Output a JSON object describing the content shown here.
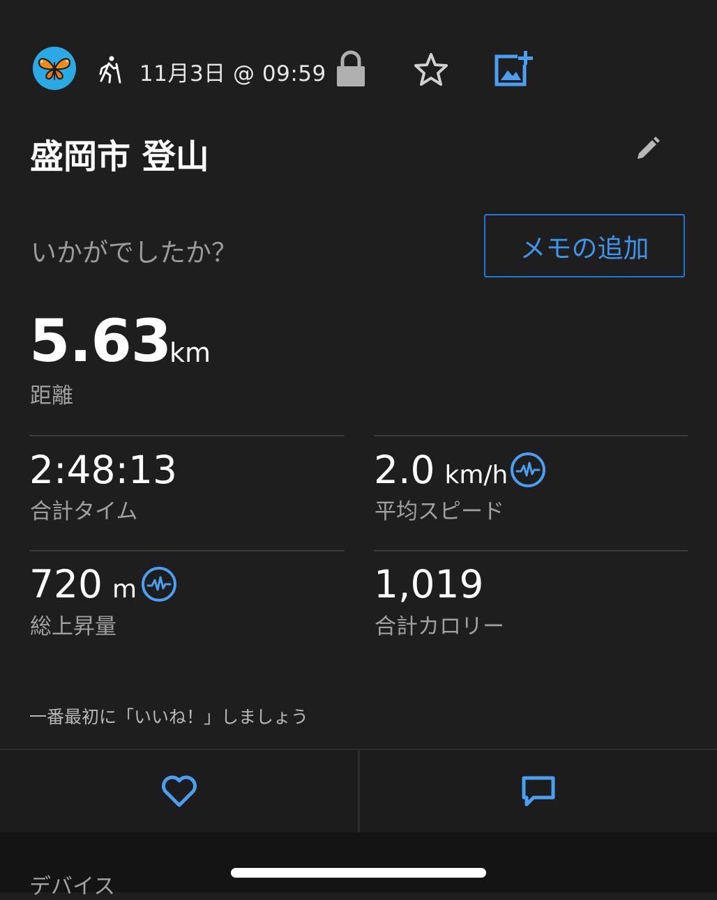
{
  "header": {
    "avatar_icon": "butterfly-avatar-icon",
    "activity_icon": "hiking-icon",
    "date_time": "11月3日 @ 09:59",
    "privacy_icon": "lock-icon",
    "favorite_icon": "star-icon",
    "add_photo_icon": "add-photo-icon"
  },
  "activity": {
    "title": "盛岡市 登山",
    "edit_icon": "pencil-icon"
  },
  "notes": {
    "prompt": "いかがでしたか？",
    "add_button": "メモの追加"
  },
  "distance": {
    "value": "5.63",
    "unit": "km",
    "label": "距離"
  },
  "stats": [
    {
      "value": "2:48:13",
      "unit": "",
      "label": "合計タイム",
      "has_pulse_icon": false
    },
    {
      "value": "2.0",
      "unit": "km/h",
      "label": "平均スピード",
      "has_pulse_icon": true
    },
    {
      "value": "720",
      "unit": "m",
      "label": "総上昇量",
      "has_pulse_icon": true
    },
    {
      "value": "1,019",
      "unit": "",
      "label": "合計カロリー",
      "has_pulse_icon": false
    }
  ],
  "social": {
    "like_hint": "一番最初に「いいね！」しましょう",
    "like_icon": "heart-icon",
    "comment_icon": "comment-icon"
  },
  "section_peek": "デバイス",
  "colors": {
    "background": "#1e1e1e",
    "accent_blue": "#3f93e8",
    "label_gray": "#a0a0a0"
  }
}
